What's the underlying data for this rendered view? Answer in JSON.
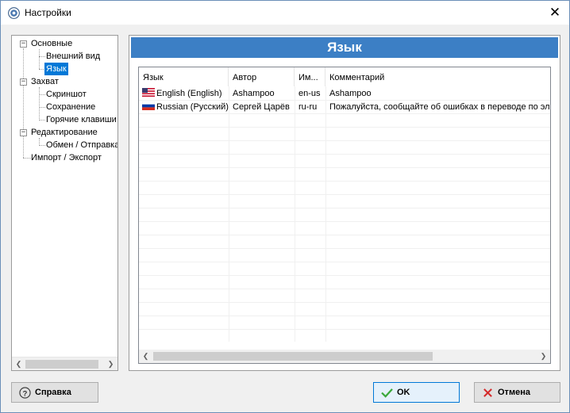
{
  "window": {
    "title": "Настройки"
  },
  "tree": {
    "nodes": [
      {
        "label": "Основные"
      },
      {
        "label": "Внешний вид"
      },
      {
        "label": "Язык"
      },
      {
        "label": "Захват"
      },
      {
        "label": "Скриншот"
      },
      {
        "label": "Сохранение"
      },
      {
        "label": "Горячие клавиши"
      },
      {
        "label": "Редактирование"
      },
      {
        "label": "Обмен / Отправка"
      },
      {
        "label": "Импорт / Экспорт"
      }
    ],
    "expander_symbol": "−"
  },
  "section": {
    "title": "Язык"
  },
  "language_list": {
    "columns": [
      "Язык",
      "Автор",
      "Им...",
      "Комментарий"
    ],
    "rows": [
      {
        "language": "English (English)",
        "author": "Ashampoo",
        "code": "en-us",
        "comment": "Ashampoo",
        "flag": "us-flag-icon"
      },
      {
        "language": "Russian (Русский)",
        "author": "Сергей Царёв",
        "code": "ru-ru",
        "comment": "Пожалуйста, сообщайте об ошибках в переводе по эл",
        "flag": "ru-flag-icon"
      }
    ]
  },
  "buttons": {
    "help": "Справка",
    "ok": "OK",
    "cancel": "Отмена"
  },
  "colors": {
    "accent": "#3c7fc5",
    "selection": "#0078d7",
    "ok_check": "#3aa83a",
    "cancel_x": "#d42a2a"
  }
}
